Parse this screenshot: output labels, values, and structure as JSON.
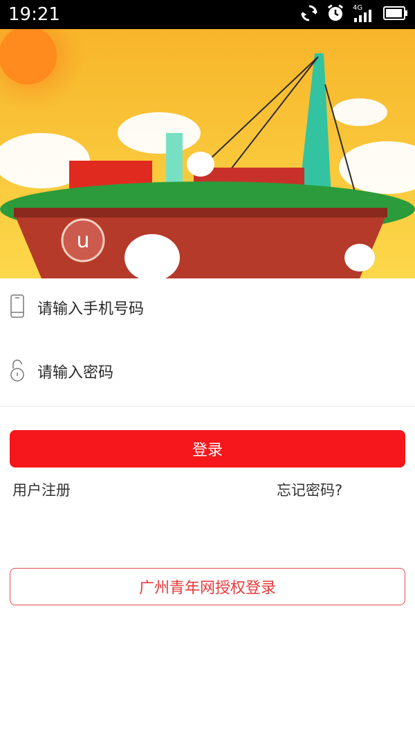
{
  "status_bar": {
    "time": "19:21",
    "network": "4G"
  },
  "login": {
    "phone_placeholder": "请输入手机号码",
    "password_placeholder": "请输入密码",
    "login_button": "登录",
    "register_link": "用户注册",
    "forgot_link": "忘记密码?",
    "auth_button": "广州青年网授权登录"
  },
  "colors": {
    "accent": "#f5171b",
    "auth_border": "#e74b4b"
  }
}
